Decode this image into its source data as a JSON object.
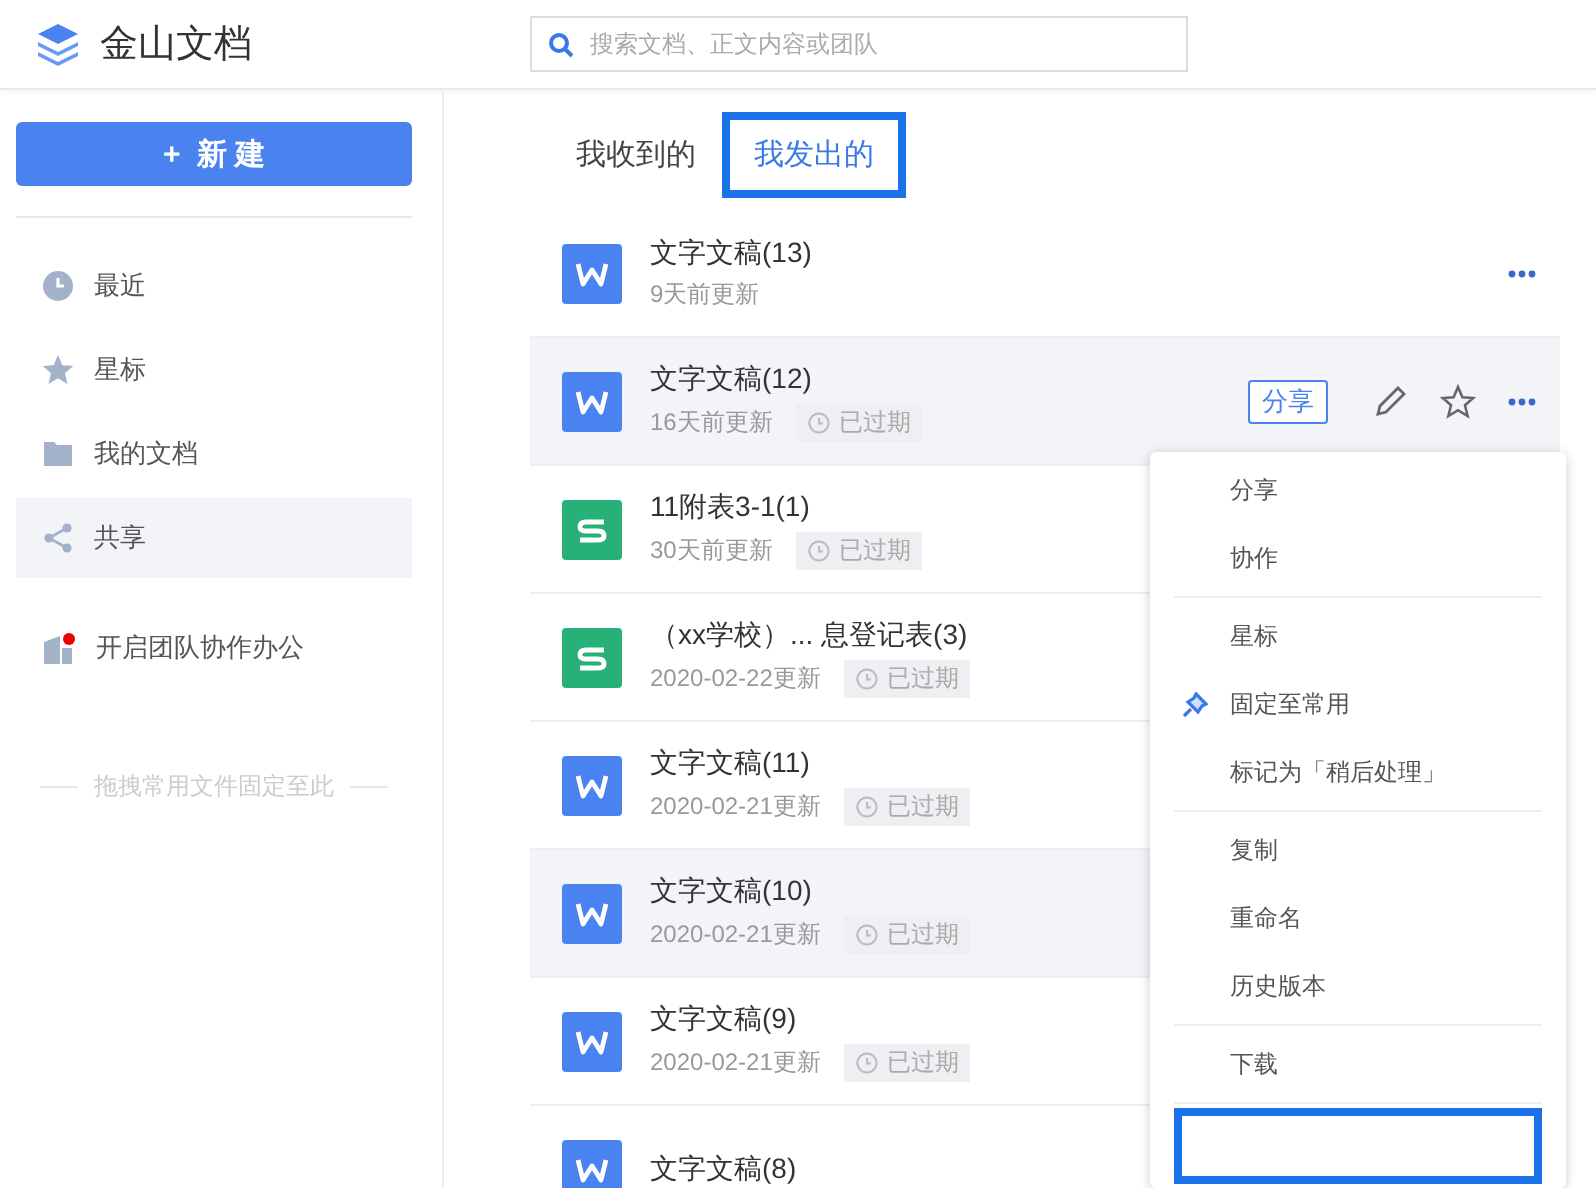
{
  "app": {
    "title": "金山文档"
  },
  "search": {
    "placeholder": "搜索文档、正文内容或团队"
  },
  "sidebar": {
    "new_button": {
      "icon": "+",
      "label": "新 建"
    },
    "items": [
      {
        "kind": "recent",
        "label": "最近",
        "selected": false
      },
      {
        "kind": "star",
        "label": "星标",
        "selected": false
      },
      {
        "kind": "folder",
        "label": "我的文档",
        "selected": false
      },
      {
        "kind": "share",
        "label": "共享",
        "selected": true
      }
    ],
    "team": {
      "label": "开启团队协作办公",
      "notification": true
    },
    "pin_hint": "拖拽常用文件固定至此"
  },
  "tabs": [
    {
      "label": "我收到的",
      "selected": false
    },
    {
      "label": "我发出的",
      "selected": true
    }
  ],
  "files": [
    {
      "kind": "doc",
      "name": "文字文稿(13)",
      "updated": "9天前更新",
      "expired": false,
      "highlighted": false,
      "more": true
    },
    {
      "kind": "doc",
      "name": "文字文稿(12)",
      "updated": "16天前更新",
      "expired": true,
      "expired_label": "已过期",
      "highlighted": true,
      "more": true,
      "share_label": "分享"
    },
    {
      "kind": "sheet",
      "name": "11附表3-1(1)",
      "updated": "30天前更新",
      "expired": true,
      "expired_label": "已过期",
      "highlighted": false
    },
    {
      "kind": "sheet",
      "name": "（xx学校）... 息登记表(3)",
      "updated": "2020-02-22更新",
      "expired": true,
      "expired_label": "已过期",
      "highlighted": false
    },
    {
      "kind": "doc",
      "name": "文字文稿(11)",
      "updated": "2020-02-21更新",
      "expired": true,
      "expired_label": "已过期",
      "highlighted": false
    },
    {
      "kind": "doc",
      "name": "文字文稿(10)",
      "updated": "2020-02-21更新",
      "expired": true,
      "expired_label": "已过期",
      "highlighted": true
    },
    {
      "kind": "doc",
      "name": "文字文稿(9)",
      "updated": "2020-02-21更新",
      "expired": true,
      "expired_label": "已过期",
      "highlighted": false
    },
    {
      "kind": "doc",
      "name": "文字文稿(8)",
      "highlighted": false
    }
  ],
  "context_menu": {
    "groups": [
      [
        {
          "label": "分享",
          "pinned": false
        },
        {
          "label": "协作",
          "pinned": false
        }
      ],
      [
        {
          "label": "星标",
          "pinned": false
        },
        {
          "label": "固定至常用",
          "pinned": true
        },
        {
          "label": "标记为「稍后处理」",
          "pinned": false
        }
      ],
      [
        {
          "label": "复制",
          "pinned": false
        },
        {
          "label": "重命名",
          "pinned": false
        },
        {
          "label": "历史版本",
          "pinned": false
        }
      ],
      [
        {
          "label": "下载",
          "pinned": false
        }
      ]
    ],
    "framed_item": true
  }
}
